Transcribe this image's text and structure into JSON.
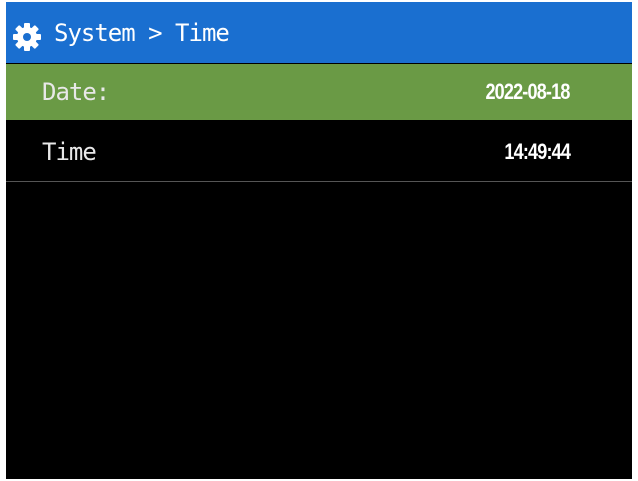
{
  "header": {
    "icon": "gear-icon",
    "title": "System > Time",
    "color": "#1a6fd0"
  },
  "rows": [
    {
      "label": "Date:",
      "value": "2022-08-18",
      "selected": true,
      "highlight_color": "#6a9a45"
    },
    {
      "label": "Time",
      "value": "14:49:44",
      "selected": false
    }
  ]
}
